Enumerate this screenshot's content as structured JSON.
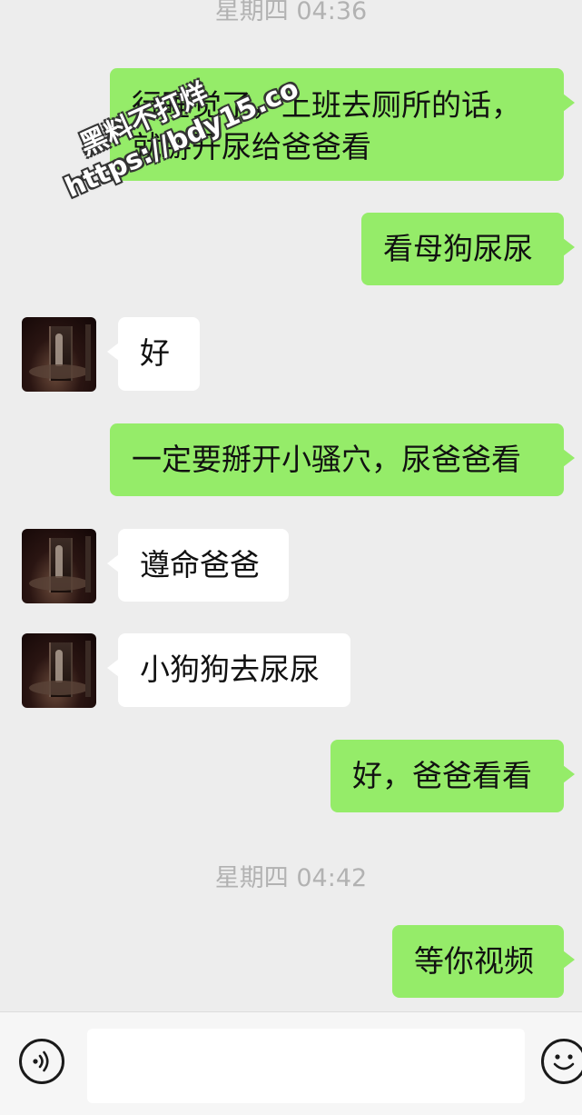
{
  "timestamps": [
    "星期四 04:36",
    "星期四 04:42"
  ],
  "messages": [
    {
      "from": "me",
      "lines": [
        "行睡觉了，上班去厕所的话，",
        "就掰开尿给爸爸看"
      ]
    },
    {
      "from": "me",
      "text": "看母狗尿尿"
    },
    {
      "from": "other",
      "text": "好"
    },
    {
      "from": "me",
      "text": "一定要掰开小骚穴，尿爸爸看"
    },
    {
      "from": "other",
      "text": "遵命爸爸"
    },
    {
      "from": "other",
      "text": "小狗狗去尿尿"
    },
    {
      "from": "me",
      "text": "好，爸爸看看"
    },
    {
      "from": "me",
      "text": "等你视频"
    }
  ],
  "watermark": {
    "line1": "黑料不打烊",
    "line2": "https://bdy15.co"
  },
  "input_bar": {
    "voice_icon": "voice-icon",
    "emoji_icon": "emoji-icon",
    "input_value": ""
  },
  "colors": {
    "background": "#ededed",
    "outgoing_bubble": "#95ec69",
    "incoming_bubble": "#ffffff",
    "timestamp": "#b2b2b2"
  }
}
